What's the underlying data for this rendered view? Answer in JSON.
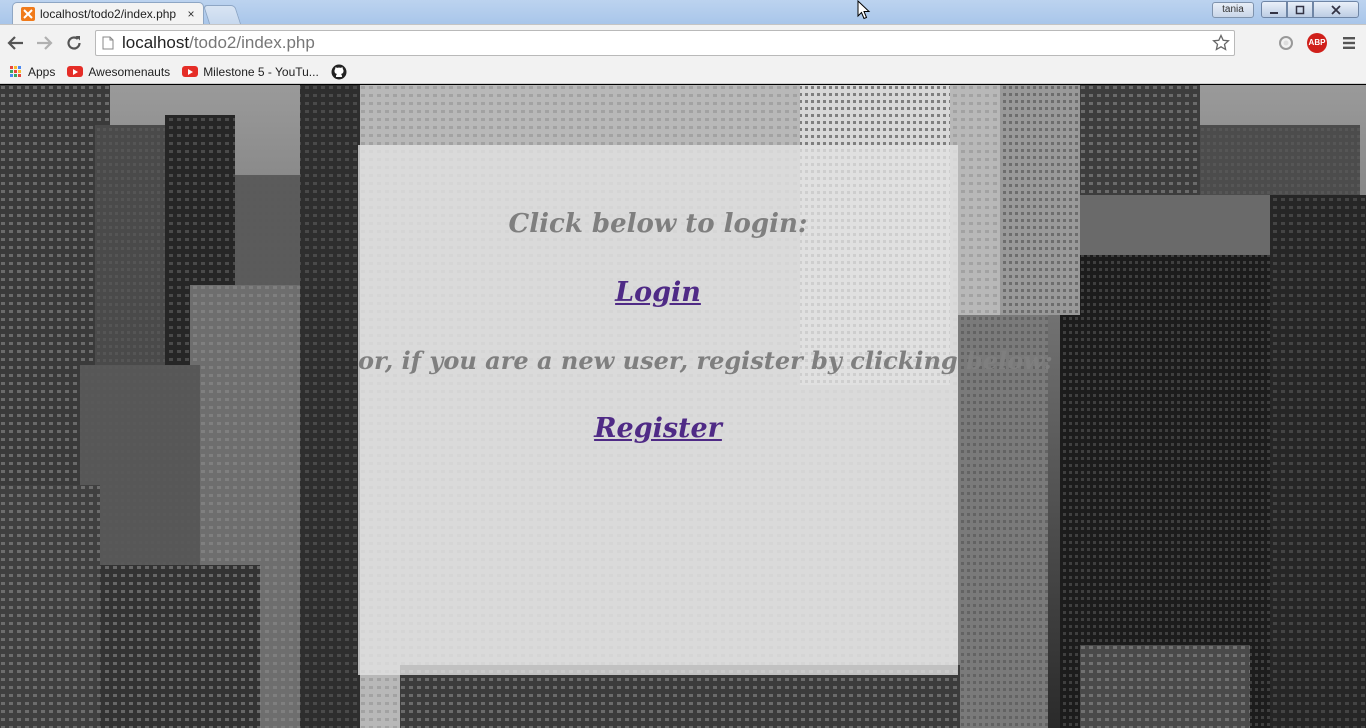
{
  "browser": {
    "tab_title": "localhost/todo2/index.php",
    "tab_close": "×",
    "profile_name": "tania",
    "url_host": "localhost",
    "url_path": "/todo2/index.php",
    "abp_label": "ABP",
    "bookmarks": [
      {
        "label": "Apps",
        "icon": "apps-grid-icon"
      },
      {
        "label": "Awesomenauts",
        "icon": "youtube-icon"
      },
      {
        "label": "Milestone 5 - YouTu...",
        "icon": "youtube-icon"
      },
      {
        "label": "",
        "icon": "github-icon"
      }
    ]
  },
  "page": {
    "login_prompt": "Click below to login:",
    "login_link": "Login",
    "register_prompt": "or, if you are a new user, register by clicking below:",
    "register_link": "Register"
  },
  "colors": {
    "link": "#4f2a86",
    "prompt_text": "#7f7f7f",
    "panel": "rgba(226,226,226,0.80)"
  }
}
